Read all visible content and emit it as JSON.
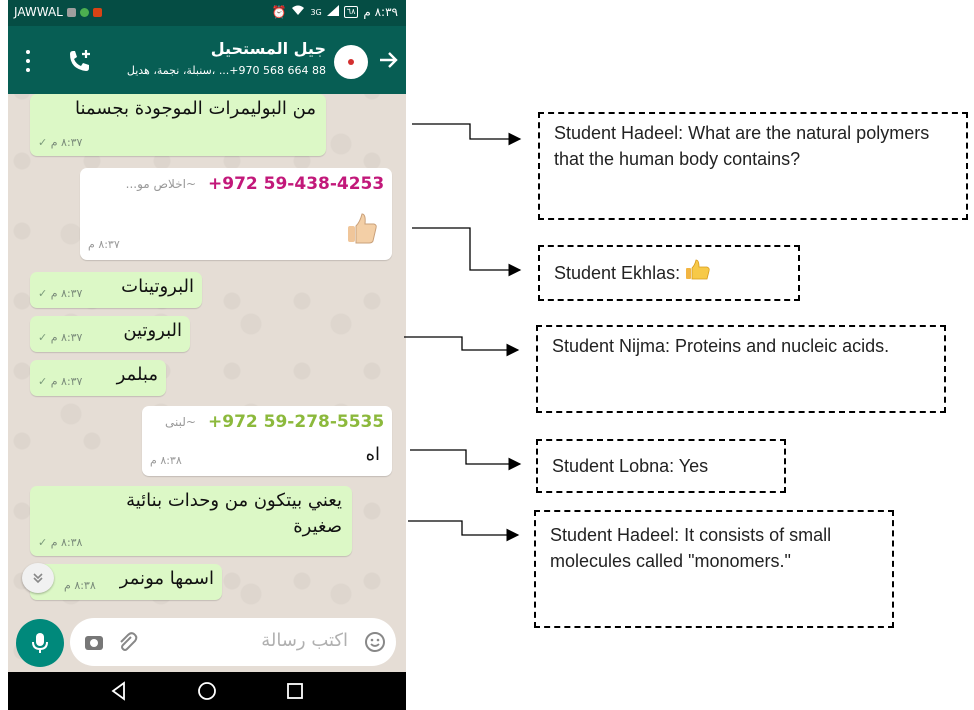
{
  "status_bar": {
    "carrier": "JAWWAL",
    "time": "٨:٣٩ م",
    "battery": "٦٨",
    "network": "3G"
  },
  "header": {
    "contact_name": "جيل المستحيل",
    "members": "سنبلة، نجمة، هديل، ...‎+970 568 664 88"
  },
  "messages": [
    {
      "id": "m1",
      "text": "من البوليمرات الموجودة بجسمنا",
      "time": "٨:٣٧ م"
    },
    {
      "id": "m2",
      "sender": "+972 59-438-4253",
      "nickname": "~اخلاص مو...",
      "text": "👍",
      "time": "٨:٣٧ م"
    },
    {
      "id": "m3",
      "text": "البروتينات",
      "time": "٨:٣٧ م"
    },
    {
      "id": "m4",
      "text": "البروتين",
      "time": "٨:٣٧ م"
    },
    {
      "id": "m5",
      "text": "مبلمر",
      "time": "٨:٣٧ م"
    },
    {
      "id": "m6",
      "sender": "+972 59-278-5535",
      "nickname": "~لبنى",
      "text": "اه",
      "time": "٨:٣٨ م"
    },
    {
      "id": "m7",
      "text_line1": "يعني بيتكون من وحدات بنائية",
      "text_line2": "صغيرة",
      "time": "٨:٣٨ م"
    },
    {
      "id": "m8",
      "text": "اسمها مونمر",
      "time": "٨:٣٨ م"
    }
  ],
  "input": {
    "placeholder": "اكتب رسالة"
  },
  "annotations": {
    "a1": "Student Hadeel: What are the natural polymers that the human body contains?",
    "a2": "Student Ekhlas:",
    "a3": "Student Nijma: Proteins and nucleic acids.",
    "a4": "Student Lobna: Yes",
    "a5": "Student Hadeel: It consists of small molecules called \"monomers.\""
  },
  "colors": {
    "header": "#075e54",
    "status_bar": "#054d44",
    "incoming_bubble": "#dcf8c6",
    "outgoing_bubble": "#ffffff",
    "sender1": "#c2187a",
    "sender2": "#8cb93c",
    "mic_button": "#00897b"
  },
  "icons": [
    "menu-icon",
    "add-call-icon",
    "back-arrow-icon",
    "thumbs-up-icon",
    "scroll-down-icon",
    "mic-icon",
    "camera-icon",
    "attach-icon",
    "emoji-icon",
    "nav-back-icon",
    "nav-home-icon",
    "nav-recents-icon"
  ]
}
